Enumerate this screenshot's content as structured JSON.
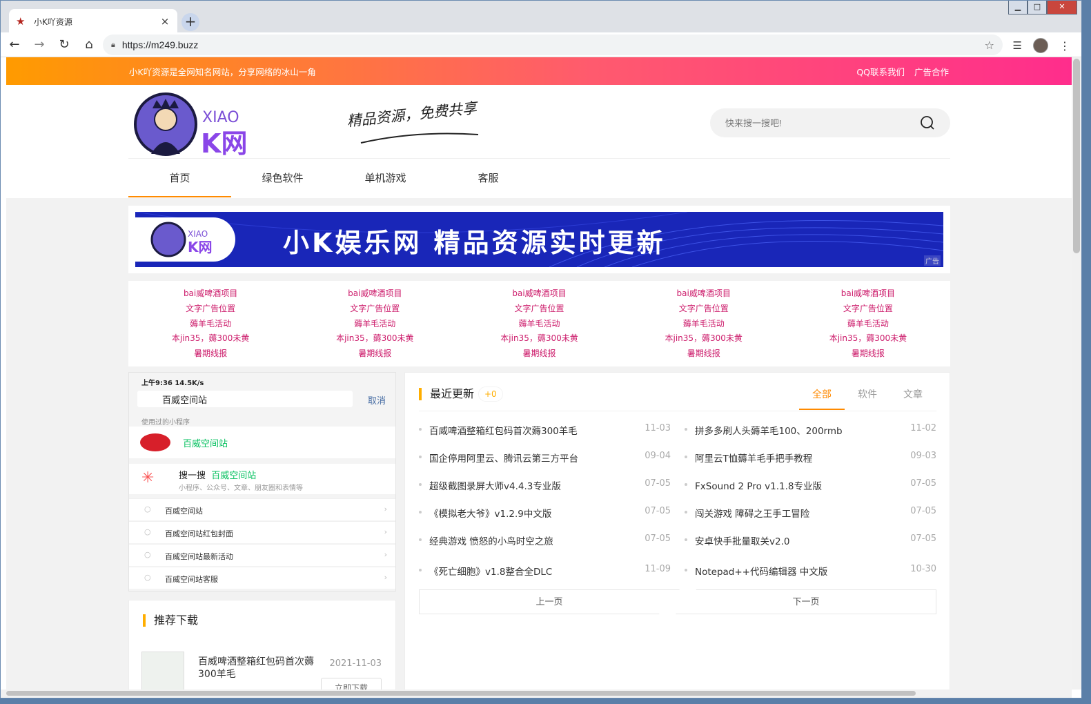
{
  "browser": {
    "tab_title": "小K吖资源",
    "url": "https://m249.buzz",
    "new_tab_symbol": "+",
    "close_tab_symbol": "×"
  },
  "topbar": {
    "notice": "小K吖资源是全网知名网站，分享网络的冰山一角",
    "links": [
      "QQ联系我们",
      "广告合作"
    ]
  },
  "header": {
    "logo_text_top": "XIAO",
    "logo_text_bottom": "K网",
    "slogan": "精品资源，免费共享",
    "search_placeholder": "快来搜一搜吧!"
  },
  "nav": {
    "items": [
      "首页",
      "绿色软件",
      "单机游戏",
      "客服"
    ],
    "active_index": 0
  },
  "banner": {
    "text": "小K娱乐网  精品资源实时更新",
    "logo_top": "XIAO",
    "logo_bottom": "K网",
    "ad_tag": "广告"
  },
  "text_ads": [
    [
      "bai威啤酒项目",
      "文字广告位置",
      "薅羊毛活动",
      "本jin35，薅300未黄",
      "暑期线报"
    ],
    [
      "bai威啤酒项目",
      "文字广告位置",
      "薅羊毛活动",
      "本jin35，薅300未黄",
      "暑期线报"
    ],
    [
      "bai威啤酒项目",
      "文字广告位置",
      "薅羊毛活动",
      "本jin35，薅300未黄",
      "暑期线报"
    ],
    [
      "bai威啤酒项目",
      "文字广告位置",
      "薅羊毛活动",
      "本jin35，薅300未黄",
      "暑期线报"
    ],
    [
      "bai威啤酒项目",
      "文字广告位置",
      "薅羊毛活动",
      "本jin35，薅300未黄",
      "暑期线报"
    ]
  ],
  "phone_ad": {
    "status": "上午9:36   14.5K/s",
    "search_text": "百威空间站",
    "cancel": "取消",
    "used_label": "使用过的小程序",
    "mini_program": "百威空间站",
    "sou_prefix": "搜一搜",
    "sou_keyword": "百威空间站",
    "sou_sub": "小程序、公众号、文章、朋友圈和表情等",
    "suggestions": [
      "百威空间站",
      "百威空间站红包封面",
      "百威空间站最新活动",
      "百威空间站客服"
    ]
  },
  "recommend": {
    "title": "推荐下载",
    "item_title": "百威啤酒整箱红包码首次薅300羊毛",
    "item_date": "2021-11-03",
    "button": "立即下载"
  },
  "recent": {
    "title": "最近更新",
    "count": "+0",
    "tabs": [
      "全部",
      "软件",
      "文章"
    ],
    "active_tab": 0,
    "items_left": [
      {
        "title": "百威啤酒整箱红包码首次薅300羊毛",
        "date": "11-03"
      },
      {
        "title": "国企停用阿里云、腾讯云第三方平台",
        "date": "09-04"
      },
      {
        "title": "超级截图录屏大师v4.4.3专业版",
        "date": "07-05"
      },
      {
        "title": "《模拟老大爷》v1.2.9中文版",
        "date": "07-05"
      },
      {
        "title": "经典游戏 愤怒的小鸟时空之旅",
        "date": "07-05"
      },
      {
        "title": "《死亡细胞》v1.8整合全DLC",
        "date": "11-09"
      }
    ],
    "items_right": [
      {
        "title": "拼多多刷人头薅羊毛100、200rmb",
        "date": "11-02"
      },
      {
        "title": "阿里云T恤薅羊毛手把手教程",
        "date": "09-03"
      },
      {
        "title": "FxSound 2 Pro v1.1.8专业版",
        "date": "07-05"
      },
      {
        "title": "闯关游戏 障碍之王手工冒险",
        "date": "07-05"
      },
      {
        "title": "安卓快手批量取关v2.0",
        "date": "07-05"
      },
      {
        "title": "Notepad++代码编辑器 中文版",
        "date": "10-30"
      }
    ],
    "prev": "上一页",
    "next": "下一页"
  }
}
